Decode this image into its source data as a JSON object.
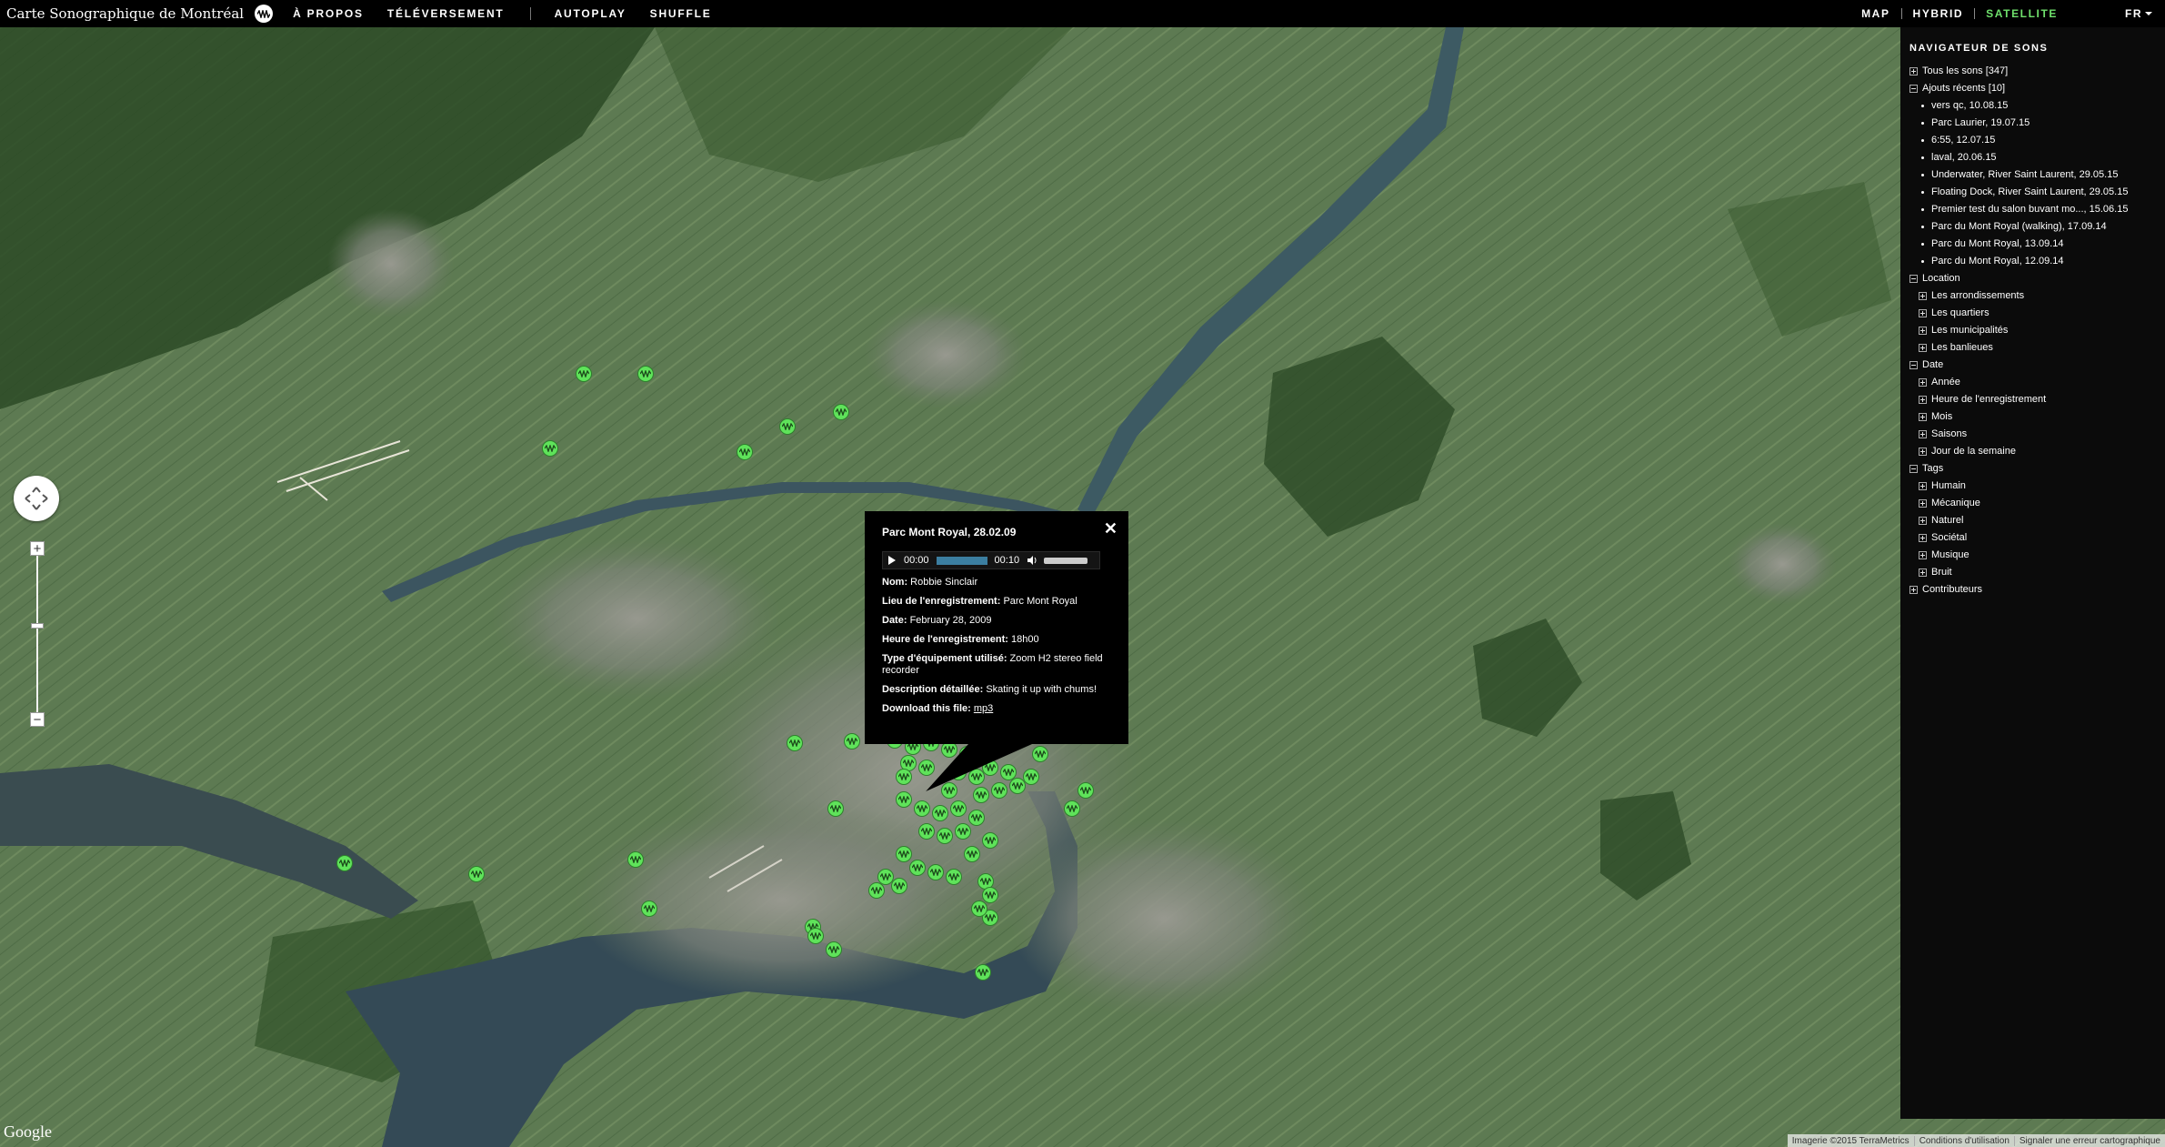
{
  "header": {
    "site_title": "Carte Sonographique de Montréal",
    "nav": [
      "À PROPOS",
      "TÉLÉVERSEMENT"
    ],
    "actions": [
      "AUTOPLAY",
      "SHUFFLE"
    ],
    "map_types": [
      "MAP",
      "HYBRID",
      "SATELLITE"
    ],
    "active_map_type": "SATELLITE",
    "language": "FR",
    "accent_color": "#6fe06c"
  },
  "popup": {
    "title": "Parc Mont Royal, 28.02.09",
    "close_label": "✕",
    "player": {
      "current_time": "00:00",
      "duration": "00:10"
    },
    "rows": [
      {
        "label": "Nom:",
        "value": "Robbie Sinclair"
      },
      {
        "label": "Lieu de l'enregistrement:",
        "value": "Parc Mont Royal"
      },
      {
        "label": "Date:",
        "value": "February 28, 2009"
      },
      {
        "label": "Heure de l'enregistrement:",
        "value": "18h00"
      },
      {
        "label": "Type d'équipement utilisé:",
        "value": "Zoom H2 stereo field recorder"
      },
      {
        "label": "Description détaillée:",
        "value": "Skating it up with chums!"
      }
    ],
    "download_label": "Download this file:",
    "download_link": "mp3"
  },
  "sidebar": {
    "title": "NAVIGATEUR DE SONS",
    "all_sounds": "Tous les sons [347]",
    "recent": "Ajouts récents [10]",
    "recent_items": [
      "vers qc, 10.08.15",
      "Parc Laurier, 19.07.15",
      "6:55, 12.07.15",
      "laval, 20.06.15",
      "Underwater, River Saint Laurent, 29.05.15",
      "Floating Dock, River Saint Laurent, 29.05.15",
      "Premier test du salon buvant mo..., 15.06.15",
      "Parc du Mont Royal (walking), 17.09.14",
      "Parc du Mont Royal, 13.09.14",
      "Parc du Mont Royal, 12.09.14"
    ],
    "location": "Location",
    "location_items": [
      "Les arrondissements",
      "Les quartiers",
      "Les municipalités",
      "Les banlieues"
    ],
    "date": "Date",
    "date_items": [
      "Année",
      "Heure de l'enregistrement",
      "Mois",
      "Saisons",
      "Jour de la semaine"
    ],
    "tags": "Tags",
    "tag_items": [
      "Humain",
      "Mécanique",
      "Naturel",
      "Sociétal",
      "Musique",
      "Bruit"
    ],
    "contributors": "Contributeurs"
  },
  "map": {
    "google_logo": "Google",
    "attribution": [
      "Imagerie ©2015 TerraMetrics",
      "Conditions d'utilisation",
      "Signaler une erreur cartographique"
    ],
    "zoom_in": "+",
    "zoom_out": "−",
    "pin_color": "#5fe35a"
  }
}
